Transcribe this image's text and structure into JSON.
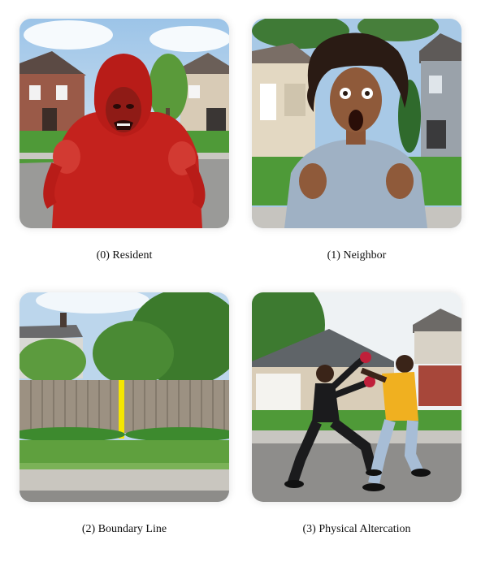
{
  "panels": [
    {
      "caption": "(0) Resident"
    },
    {
      "caption": "(1) Neighbor"
    },
    {
      "caption": "(2) Boundary Line"
    },
    {
      "caption": "(3) Physical Altercation"
    }
  ]
}
